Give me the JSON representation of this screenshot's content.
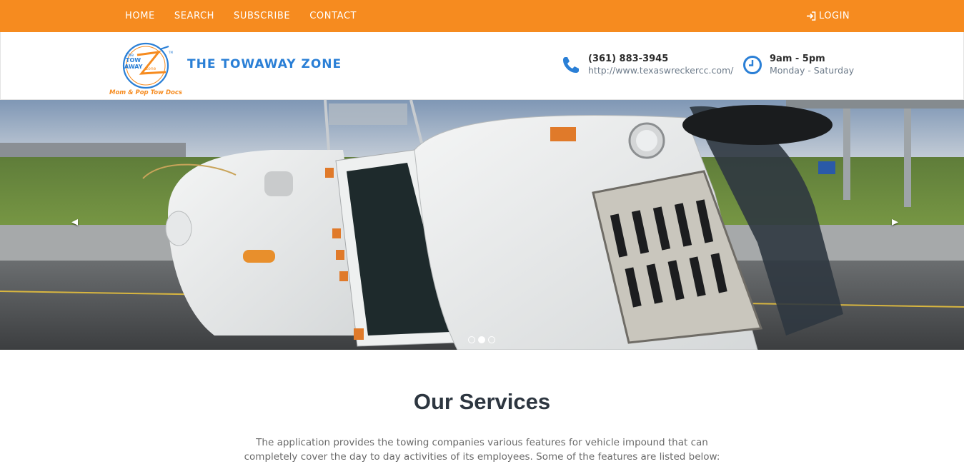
{
  "nav": {
    "items": [
      {
        "label": "HOME"
      },
      {
        "label": "SEARCH"
      },
      {
        "label": "SUBSCRIBE"
      },
      {
        "label": "CONTACT"
      }
    ],
    "login_label": "LOGIN",
    "background": "#f68b1f"
  },
  "header": {
    "logo": {
      "line1": "The",
      "line2": "TOW",
      "line3": "AWAY",
      "line4": "zone",
      "tagline": "Mom & Pop Tow Docs",
      "trademark": "TM"
    },
    "brand_name": "THE TOWAWAY ZONE",
    "phone": {
      "icon": "phone-icon",
      "number": "(361) 883-3945",
      "website": "http://www.texaswreckercc.com/"
    },
    "hours": {
      "icon": "clock-icon",
      "time": "9am - 5pm",
      "days": "Monday - Saturday"
    },
    "accent": "#2a7fd6"
  },
  "slider": {
    "prev_icon": "chevron-left-icon",
    "next_icon": "chevron-right-icon",
    "prev_glyph": "◂",
    "next_glyph": "▸",
    "slide_count": 3,
    "active_slide": 2
  },
  "services": {
    "title": "Our Services",
    "description": "The application provides the towing companies various features for vehicle impound that can completely cover the day to day activities of its employees. Some of the features are listed below:"
  }
}
